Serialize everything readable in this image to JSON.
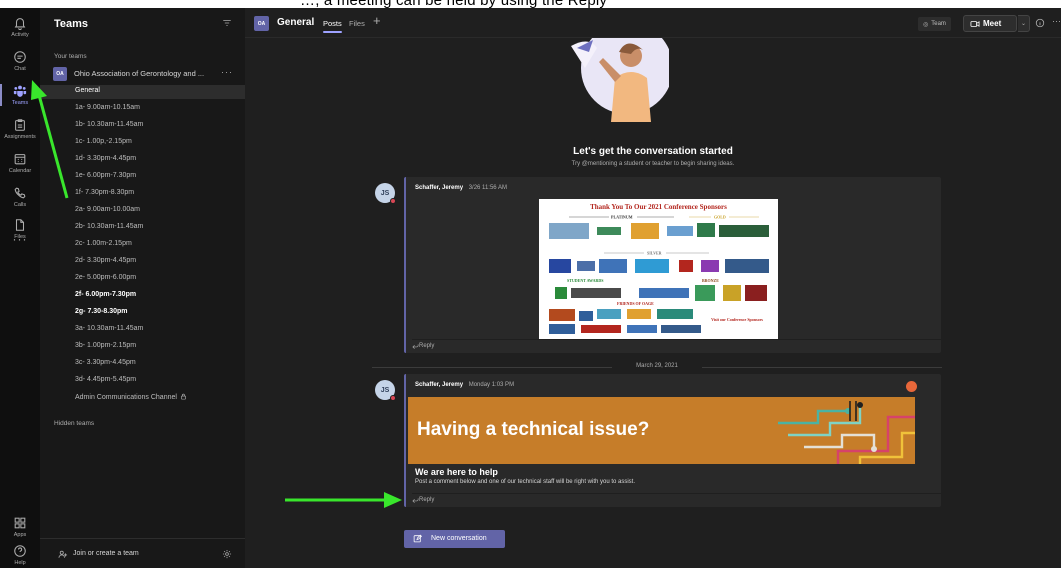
{
  "caption_fragment": "…, a meeting can be held by using the Reply",
  "rail": {
    "items": [
      {
        "label": "Activity",
        "icon": "bell-icon"
      },
      {
        "label": "Chat",
        "icon": "chat-icon"
      },
      {
        "label": "Teams",
        "icon": "teams-icon"
      },
      {
        "label": "Assignments",
        "icon": "assignments-icon"
      },
      {
        "label": "Calendar",
        "icon": "calendar-icon"
      },
      {
        "label": "Calls",
        "icon": "phone-icon"
      },
      {
        "label": "Files",
        "icon": "file-icon"
      }
    ],
    "more": "···",
    "apps_label": "Apps",
    "help_label": "Help"
  },
  "panel": {
    "title": "Teams",
    "your_teams_label": "Your teams",
    "team": {
      "initials": "OA",
      "name": "Ohio Association of Gerontology and ...",
      "more": "···"
    },
    "channels": [
      "General",
      "1a- 9.00am-10.15am",
      "1b- 10.30am-11.45am",
      "1c- 1.00p,-2.15pm",
      "1d- 3.30pm-4.45pm",
      "1e- 6.00pm-7.30pm",
      "1f- 7.30pm-8.30pm",
      "2a- 9.00am-10.00am",
      "2b- 10.30am-11.45am",
      "2c- 1.00m-2.15pm",
      "2d- 3.30pm-4.45pm",
      "2e- 5.00pm-6.00pm",
      "2f- 6.00pm-7.30pm",
      "2g- 7.30-8.30pm",
      "3a- 10.30am-11.45am",
      "3b- 1.00pm-2.15pm",
      "3c- 3.30pm-4.45pm",
      "3d- 4.45pm-5.45pm",
      "Admin Communications Channel"
    ],
    "hidden_teams_label": "Hidden teams",
    "join_label": "Join or create a team"
  },
  "header": {
    "initials": "OA",
    "title": "General",
    "tabs": [
      "Posts",
      "Files"
    ],
    "add_tab": "+",
    "team_button": "Team",
    "meet_button": "Meet",
    "more": "···"
  },
  "feed": {
    "hero_title": "Let's get the conversation started",
    "hero_subtitle": "Try @mentioning a student or teacher to begin sharing ideas.",
    "posts": [
      {
        "initials": "JS",
        "author": "Schaffer, Jeremy",
        "time": "3/26 11:56 AM",
        "reply": "Reply"
      },
      {
        "initials": "JS",
        "author": "Schaffer, Jeremy",
        "time": "Monday 1:03 PM",
        "reply": "Reply"
      }
    ],
    "date_separator": "March 29, 2021",
    "banner_title": "Having a technical issue?",
    "help_title": "We are here to help",
    "help_body": "Post a comment below and one of our technical staff will be right with you to assist.",
    "new_conversation": "New conversation"
  },
  "sponsor_image": {
    "title": "Thank You To Our 2021 Conference Sponsors",
    "tiers": [
      "PLATINUM",
      "GOLD",
      "SILVER",
      "STUDENT AWARDS",
      "BRONZE",
      "FRIENDS OF OAGE"
    ],
    "footer": "Visit our Conference Sponsors"
  },
  "colors": {
    "accent": "#6264a7",
    "arrow": "#39e62c",
    "banner": "#c67d29"
  }
}
